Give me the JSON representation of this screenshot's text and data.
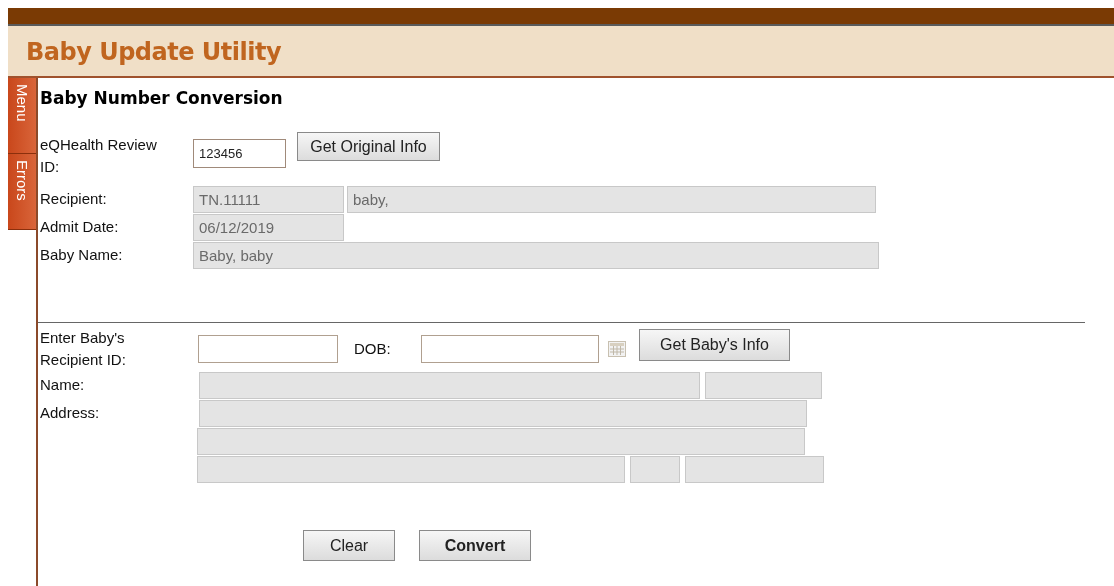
{
  "header": {
    "title": "Baby Update Utility"
  },
  "side_tabs": [
    {
      "label": "Menu"
    },
    {
      "label": "Errors"
    }
  ],
  "section_title": "Baby Number Conversion",
  "original": {
    "id_label": "eQHealth Review ID:",
    "id_field": {
      "value": "123456",
      "disabled": false
    },
    "get_button": "Get Original Info",
    "recipient_label": "Recipient:",
    "recipient_id": {
      "value": "TN.11111",
      "disabled": true
    },
    "recipient_name": {
      "value": "baby,",
      "disabled": true
    },
    "admit_label": "Admit Date:",
    "admit_date": {
      "value": "06/12/2019",
      "disabled": true
    },
    "baby_name_label": "Baby Name:",
    "baby_name": {
      "value": "Baby, baby",
      "disabled": true
    }
  },
  "new": {
    "recipient_label": "Enter Baby's Recipient ID:",
    "recipient_id": {
      "disabled": false
    },
    "dob_label": "DOB:",
    "dob": {
      "disabled": false
    },
    "get_button": "Get Baby's Info",
    "name_label": "Name:",
    "name": [
      {
        "disabled": true
      },
      {
        "disabled": true
      }
    ],
    "address_label": "Address:",
    "address": [
      [
        {
          "disabled": true
        }
      ],
      [
        {
          "disabled": true
        }
      ],
      [
        {
          "disabled": true
        },
        {
          "disabled": true
        },
        {
          "disabled": true
        }
      ]
    ]
  },
  "buttons": [
    {
      "label": "Clear",
      "bold": false
    },
    {
      "label": "Convert",
      "bold": true
    }
  ]
}
